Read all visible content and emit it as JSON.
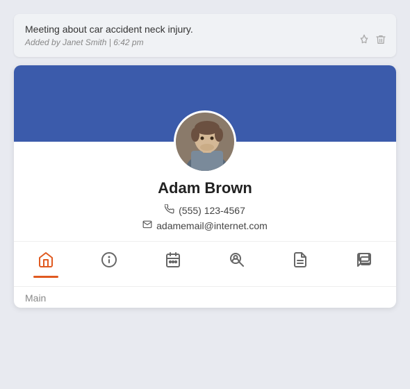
{
  "note": {
    "text": "Meeting about car accident neck injury.",
    "meta_author": "Added by Janet Smith",
    "meta_time": "6:42 pm",
    "meta_separator": "|"
  },
  "profile": {
    "name": "Adam Brown",
    "phone": "(555) 123-4567",
    "email": "adamemail@internet.com",
    "nav": [
      {
        "id": "home",
        "icon": "🏠",
        "label": "Home",
        "active": true
      },
      {
        "id": "info",
        "icon": "ℹ",
        "label": "Info",
        "active": false
      },
      {
        "id": "calendar",
        "icon": "📅",
        "label": "Calendar",
        "active": false
      },
      {
        "id": "search",
        "icon": "🔍",
        "label": "Search",
        "active": false
      },
      {
        "id": "notes",
        "icon": "📋",
        "label": "Notes",
        "active": false
      },
      {
        "id": "chat",
        "icon": "💬",
        "label": "Chat",
        "active": false
      }
    ],
    "tab_label": "Main"
  },
  "icons": {
    "phone": "📞",
    "email": "✉",
    "pin": "📌",
    "trash": "🗑"
  }
}
